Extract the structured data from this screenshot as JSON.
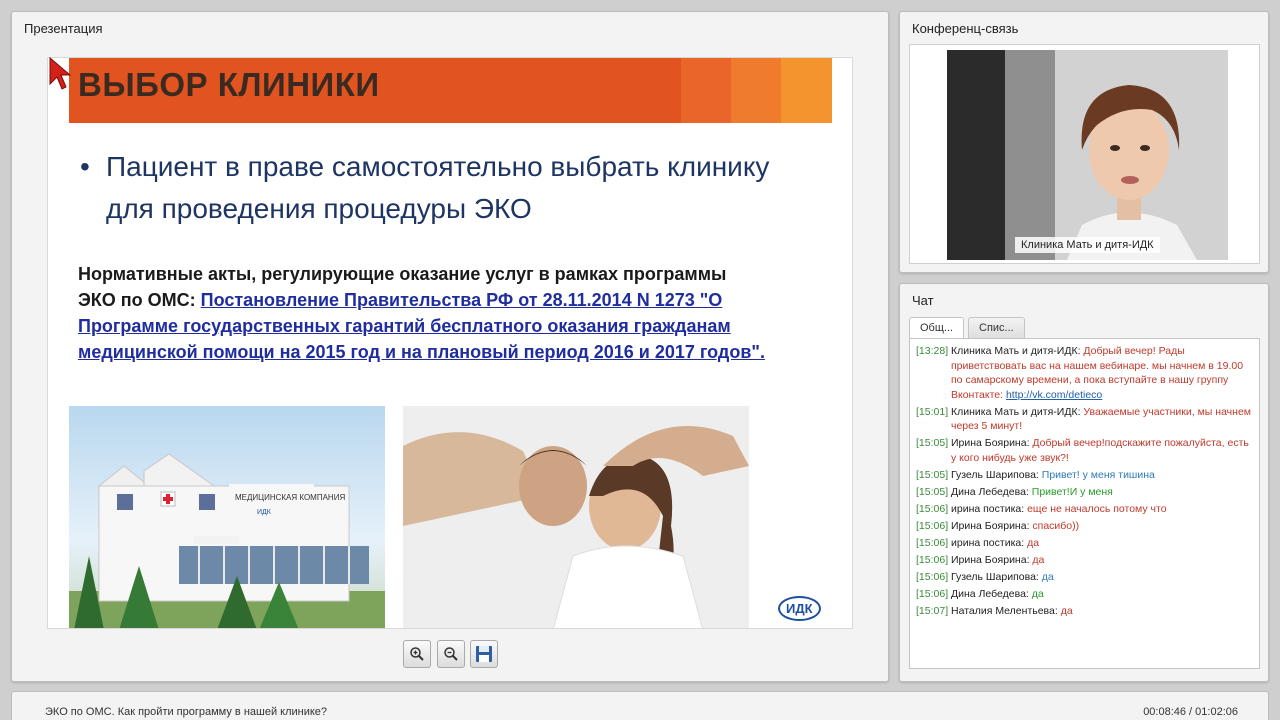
{
  "presentation": {
    "title": "Презентация",
    "slide": {
      "heading": "ВЫБОР КЛИНИКИ",
      "bullet": "Пациент в праве самостоятельно выбрать клинику для проведения процедуры ЭКО",
      "para_prefix": "Нормативные акты, регулирующие оказание услуг в рамках программы ЭКО по ОМС: ",
      "para_link": "Постановление Правительства РФ от 28.11.2014 N 1273 \"О Программе государственных гарантий бесплатного оказания гражданам медицинской помощи на 2015 год и на плановый период 2016 и 2017 годов\".",
      "building_sign": "МЕДИЦИНСКАЯ КОМПАНИЯ",
      "building_sign_logo": "ИДК",
      "logo": "ИДК"
    },
    "tools": {
      "zoom_in": "zoom-in-icon",
      "zoom_out": "zoom-out-icon",
      "save": "save-icon"
    }
  },
  "video": {
    "title": "Конференц-связь",
    "label": "Клиника Мать и дитя-ИДК"
  },
  "chat": {
    "title": "Чат",
    "tabs": [
      {
        "label": "Общ..."
      },
      {
        "label": "Спис..."
      }
    ],
    "messages": [
      {
        "time": "[13:28]",
        "author": "Клиника Мать и дитя-ИДК:",
        "text": "Добрый вечер! Рады приветствовать вас на нашем вебинаре. мы начнем в 19.00 по самарскому времени, а пока вступайте в нашу группу Вконтакте:",
        "link": "http://vk.com/detieco",
        "color": "red"
      },
      {
        "time": "[15:01]",
        "author": "Клиника Мать и дитя-ИДК:",
        "text": "Уважаемые участники, мы начнем через 5 минут!",
        "color": "red"
      },
      {
        "time": "[15:05]",
        "author": "Ирина Боярина:",
        "text": "Добрый вечер!подскажите пожалуйста, есть у кого нибудь уже звук?!",
        "color": "red"
      },
      {
        "time": "[15:05]",
        "author": "Гузель Шарипова:",
        "text": "Привет! у меня тишина",
        "color": "blue"
      },
      {
        "time": "[15:05]",
        "author": "Дина Лебедева:",
        "text": "Привет!И у меня",
        "color": "green"
      },
      {
        "time": "[15:06]",
        "author": "ирина постика:",
        "text": "еще не началось потому что",
        "color": "red"
      },
      {
        "time": "[15:06]",
        "author": "Ирина Боярина:",
        "text": "спасибо))",
        "color": "red"
      },
      {
        "time": "[15:06]",
        "author": "ирина постика:",
        "text": "да",
        "color": "red"
      },
      {
        "time": "[15:06]",
        "author": "Ирина Боярина:",
        "text": "да",
        "color": "red"
      },
      {
        "time": "[15:06]",
        "author": "Гузель Шарипова:",
        "text": "да",
        "color": "blue"
      },
      {
        "time": "[15:06]",
        "author": "Дина Лебедева:",
        "text": "да",
        "color": "green"
      },
      {
        "time": "[15:07]",
        "author": "Наталия Мелентьева:",
        "text": "да",
        "color": "red"
      }
    ]
  },
  "footer": {
    "title": "ЭКО по ОМС. Как пройти программу в нашей клинике?",
    "time": "00:08:46 / 01:02:06"
  },
  "colors": {
    "header_orange": "#e2541f",
    "text_navy": "#1e3563",
    "link_blue": "#1f2d9e"
  }
}
